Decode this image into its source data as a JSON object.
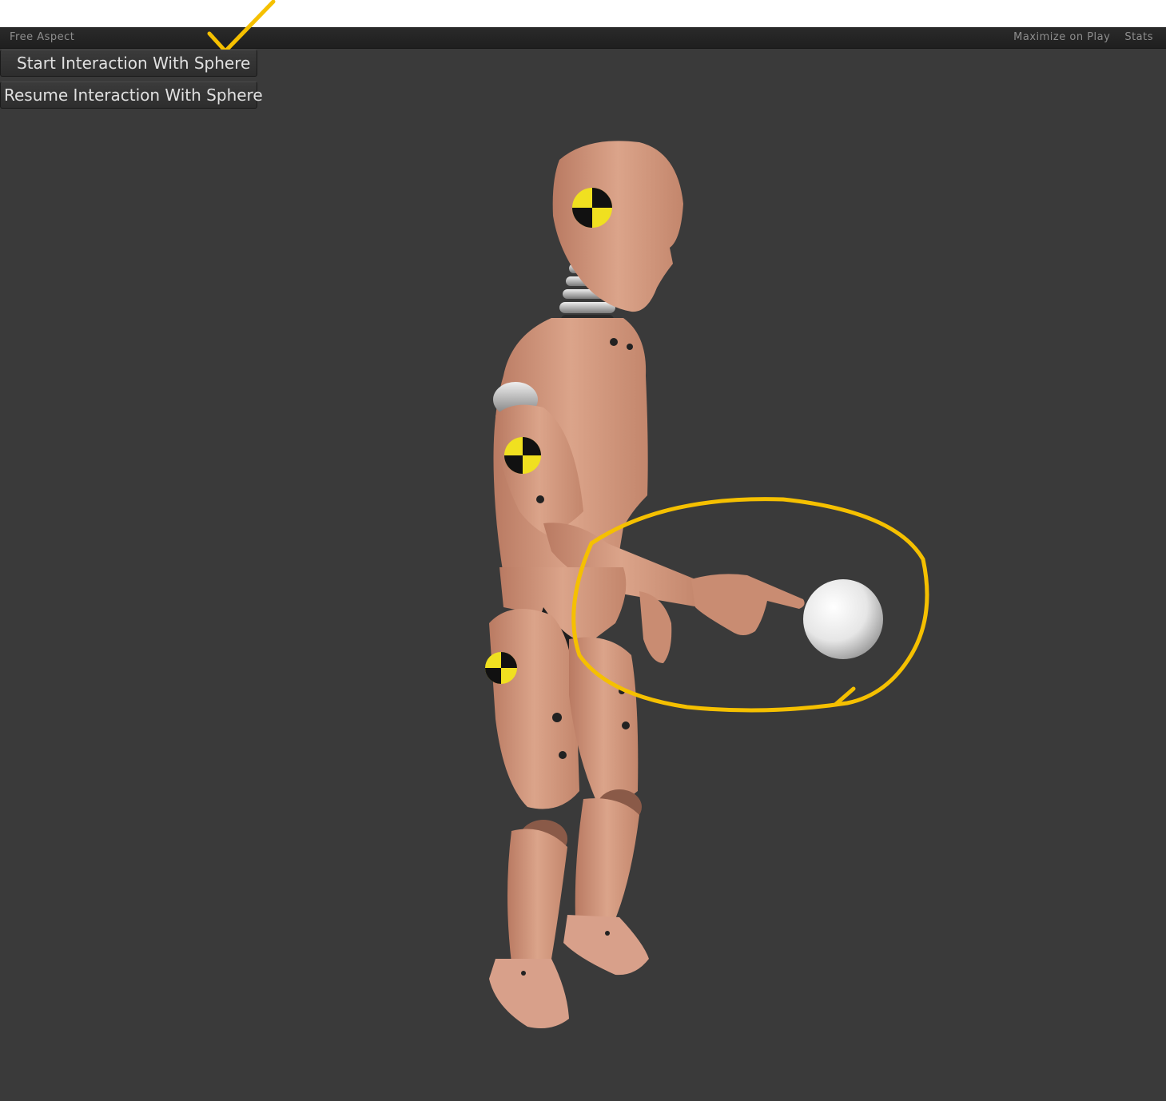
{
  "toolbar": {
    "aspect_label": "Free Aspect",
    "aspect_caret": "▾",
    "maximize_label": "Maximize on Play",
    "stats_label": "Stats"
  },
  "buttons": {
    "start_label": "Start Interaction With Sphere",
    "resume_label": "Resume Interaction With Sphere"
  },
  "colors": {
    "annotation": "#f5c000",
    "viewport_bg": "#3a3a3a",
    "skin": "#d49a80",
    "marker_yellow": "#f0e020"
  }
}
